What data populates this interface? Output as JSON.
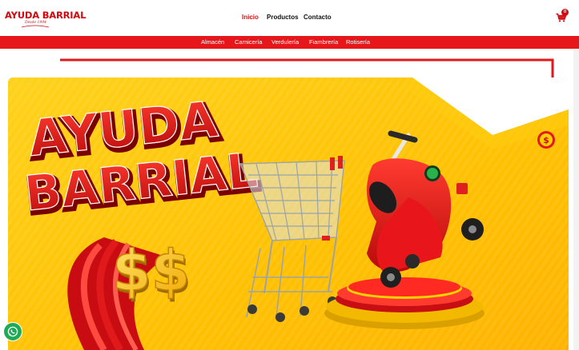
{
  "brand": {
    "name": "AYUDA BARRIAL",
    "tagline": "Desde 1994"
  },
  "nav": {
    "items": [
      {
        "label": "Inicio",
        "active": true
      },
      {
        "label": "Productos",
        "active": false
      },
      {
        "label": "Contacto",
        "active": false
      }
    ]
  },
  "cart": {
    "icon": "shopping-cart-icon",
    "count": "0"
  },
  "categories": [
    "Almacén",
    "Carnicería",
    "Verdulería",
    "Fiambrería",
    "Rotisería"
  ],
  "hero": {
    "headline_line1": "AYUDA",
    "headline_line2": "BARRIAL",
    "money_symbol": "$$",
    "coin_symbol": "$"
  },
  "floating": {
    "whatsapp_icon": "whatsapp-icon"
  },
  "colors": {
    "brand_red": "#e5171b",
    "hero_yellow": "#ffc400",
    "whatsapp_green": "#1faa57"
  }
}
